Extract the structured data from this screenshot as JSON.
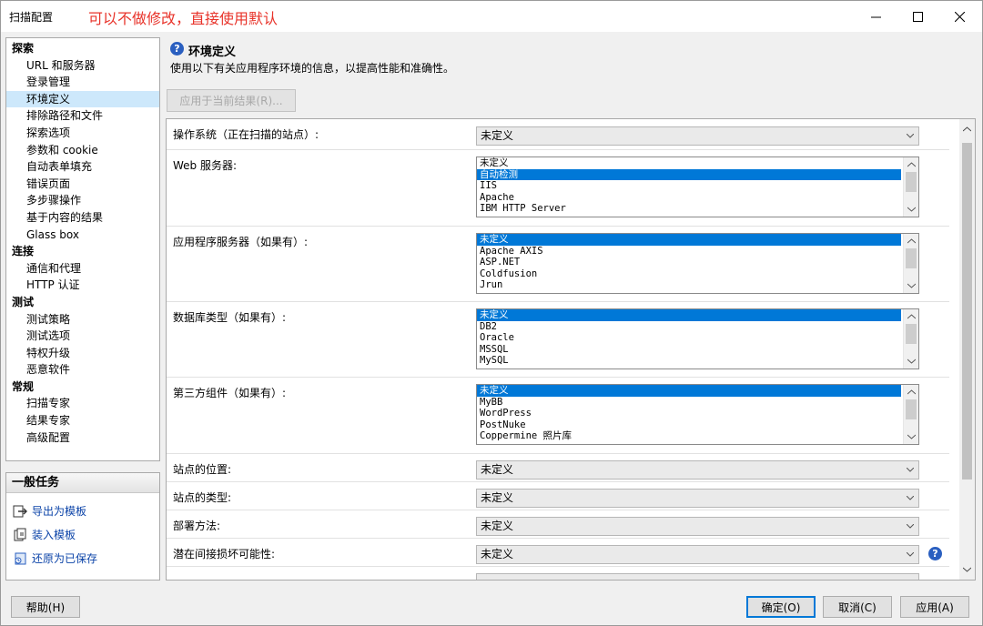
{
  "window": {
    "title": "扫描配置",
    "annotation": "可以不做修改，直接使用默认"
  },
  "nav": {
    "groups": [
      {
        "label": "探索",
        "items": [
          "URL 和服务器",
          "登录管理",
          "环境定义",
          "排除路径和文件",
          "探索选项",
          "参数和 cookie",
          "自动表单填充",
          "错误页面",
          "多步骤操作",
          "基于内容的结果",
          "Glass box"
        ]
      },
      {
        "label": "连接",
        "items": [
          "通信和代理",
          "HTTP 认证"
        ]
      },
      {
        "label": "测试",
        "items": [
          "测试策略",
          "测试选项",
          "特权升级",
          "恶意软件"
        ]
      },
      {
        "label": "常规",
        "items": [
          "扫描专家",
          "结果专家",
          "高级配置"
        ]
      }
    ],
    "selected": "环境定义"
  },
  "tasks": {
    "title": "一般任务",
    "items": [
      "导出为模板",
      "装入模板",
      "还原为已保存"
    ]
  },
  "header": {
    "title": "环境定义",
    "description": "使用以下有关应用程序环境的信息，以提高性能和准确性。",
    "apply_button": "应用于当前结果(R)..."
  },
  "form": {
    "os": {
      "label": "操作系统（正在扫描的站点）:",
      "value": "未定义"
    },
    "web_server": {
      "label": "Web 服务器:",
      "options": [
        "未定义",
        "自动检测",
        "IIS",
        "Apache",
        "IBM HTTP Server"
      ],
      "selected": 1
    },
    "app_server": {
      "label": "应用程序服务器（如果有）:",
      "options": [
        "未定义",
        "Apache AXIS",
        "ASP.NET",
        "Coldfusion",
        "Jrun"
      ],
      "selected": 0
    },
    "db": {
      "label": "数据库类型（如果有）:",
      "options": [
        "未定义",
        "DB2",
        "Oracle",
        "MSSQL",
        "MySQL"
      ],
      "selected": 0
    },
    "third_party": {
      "label": "第三方组件（如果有）:",
      "options": [
        "未定义",
        "MyBB",
        "WordPress",
        "PostNuke",
        "Coppermine 照片库"
      ],
      "selected": 0
    },
    "site_location": {
      "label": "站点的位置:",
      "value": "未定义"
    },
    "site_type": {
      "label": "站点的类型:",
      "value": "未定义"
    },
    "deploy": {
      "label": "部署方法:",
      "value": "未定义"
    },
    "damage": {
      "label": "潜在间接损坏可能性:",
      "value": "未定义"
    }
  },
  "buttons": {
    "help": "帮助(H)",
    "ok": "确定(O)",
    "cancel": "取消(C)",
    "apply": "应用(A)"
  },
  "colors": {
    "selection": "#0078d7",
    "nav_selected": "#cde8fb",
    "annotation": "#e8332a",
    "link": "#0b43a8"
  }
}
